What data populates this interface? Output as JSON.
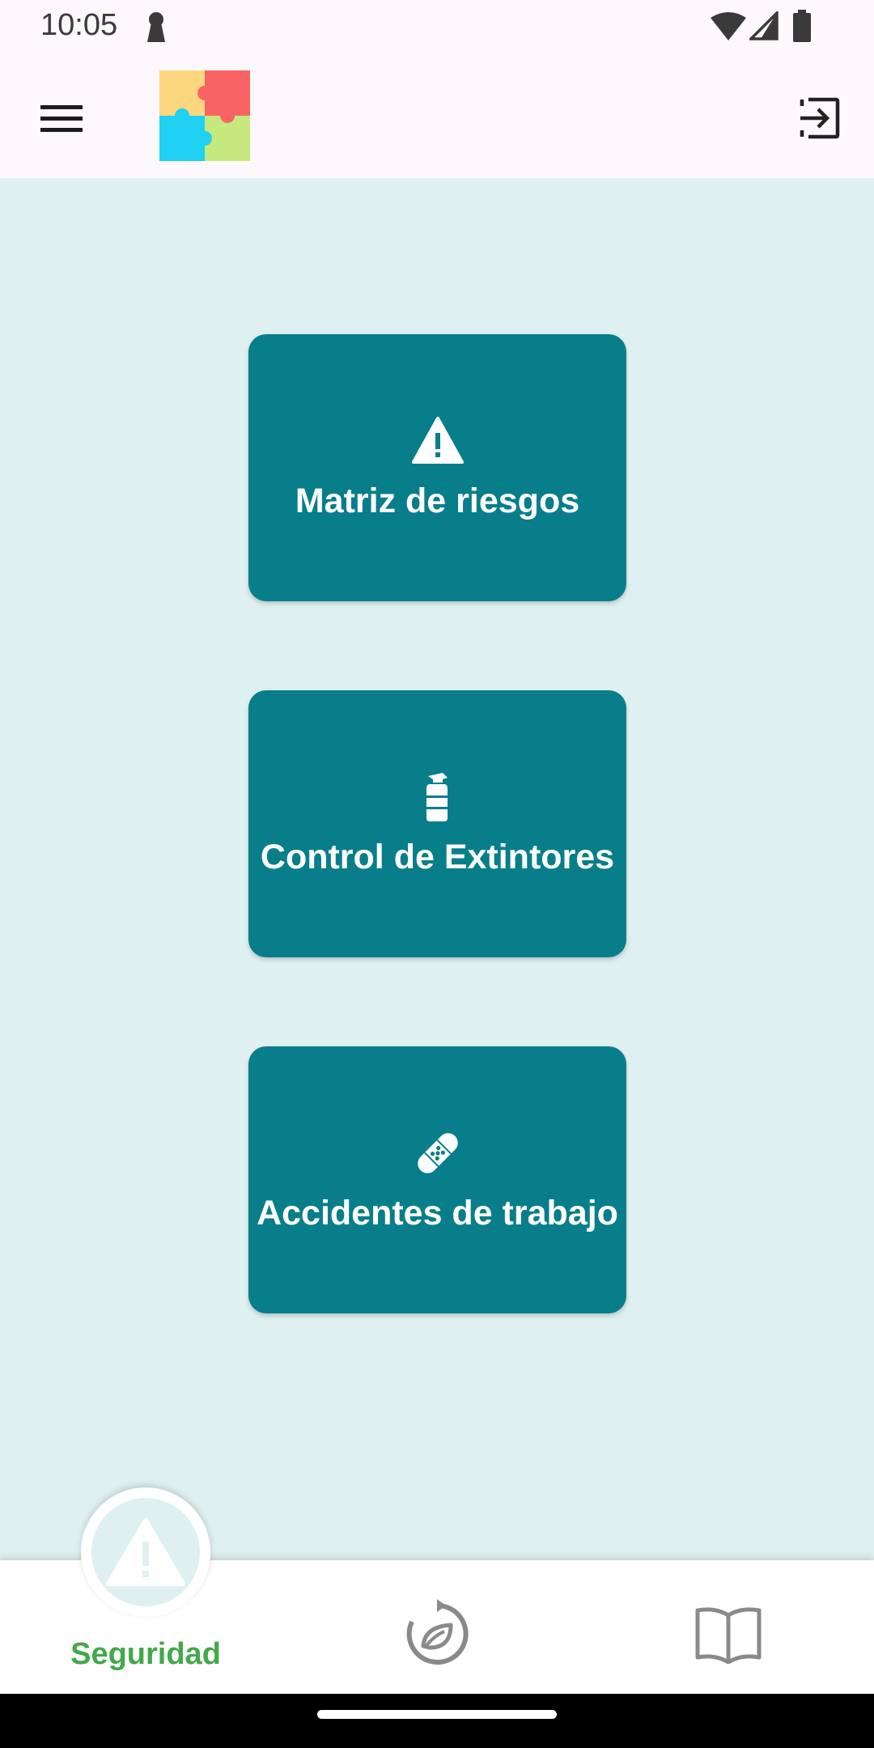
{
  "status_bar": {
    "time": "10:05",
    "icons": [
      "lock-keyhole-icon",
      "wifi-icon",
      "signal-icon",
      "battery-icon"
    ]
  },
  "app_bar": {
    "menu_icon": "hamburger-menu-icon",
    "logo_icon": "puzzle-logo-icon",
    "logout_icon": "logout-icon",
    "logo_colors": [
      "#fdd77f",
      "#f86464",
      "#1fd0f2",
      "#c7e87c"
    ]
  },
  "cards": [
    {
      "label": "Matriz de riesgos",
      "icon": "warning-icon"
    },
    {
      "label": "Control de Extintores",
      "icon": "fire-extinguisher-icon"
    },
    {
      "label": "Accidentes de trabajo",
      "icon": "bandage-icon"
    }
  ],
  "bottom_nav": {
    "items": [
      {
        "label": "Seguridad",
        "icon": "warning-icon",
        "active": true
      },
      {
        "label": "",
        "icon": "eco-refresh-icon",
        "active": false
      },
      {
        "label": "",
        "icon": "book-icon",
        "active": false
      }
    ]
  },
  "colors": {
    "background": "#dff0f0",
    "card": "#087e8b",
    "active_label": "#43a84a",
    "app_bar": "#fdf8fc"
  }
}
